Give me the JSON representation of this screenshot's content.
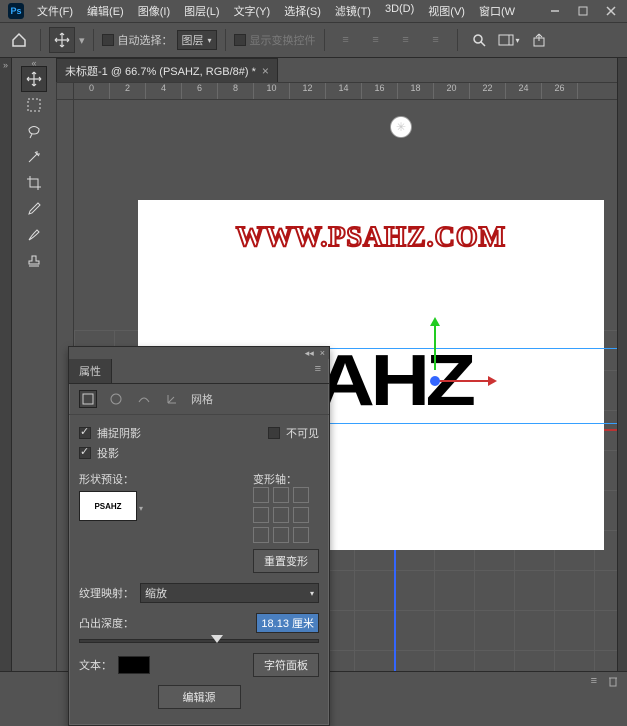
{
  "app": {
    "logo": "Ps"
  },
  "menu": [
    "文件(F)",
    "编辑(E)",
    "图像(I)",
    "图层(L)",
    "文字(Y)",
    "选择(S)",
    "滤镜(T)",
    "3D(D)",
    "视图(V)",
    "窗口(W"
  ],
  "optbar": {
    "autoselect_label": "自动选择：",
    "autoselect_value": "图层",
    "transform_label": "显示变换控件"
  },
  "tab": {
    "title": "未标题-1 @ 66.7% (PSAHZ, RGB/8#) *"
  },
  "ruler": [
    "0",
    "2",
    "4",
    "6",
    "8",
    "10",
    "12",
    "14",
    "16",
    "18",
    "20",
    "22",
    "24",
    "26"
  ],
  "canvas": {
    "watermark": "WWW.PSAHZ.COM",
    "text3d": "SAHZ"
  },
  "panel": {
    "title": "属性",
    "tabs": [
      "网格"
    ],
    "capture_shadow": "捕捉阴影",
    "cast_shadow": "投影",
    "invisible": "不可见",
    "shape_preset": "形状预设：",
    "preset_text": "PSAHZ",
    "deform_axis": "变形轴：",
    "reset_deform": "重置变形",
    "texture_map": "纹理映射：",
    "texture_value": "缩放",
    "extrude_depth": "凸出深度：",
    "extrude_value": "18.13 厘米",
    "text_label": "文本：",
    "char_panel": "字符面板",
    "edit_source": "编辑源"
  }
}
